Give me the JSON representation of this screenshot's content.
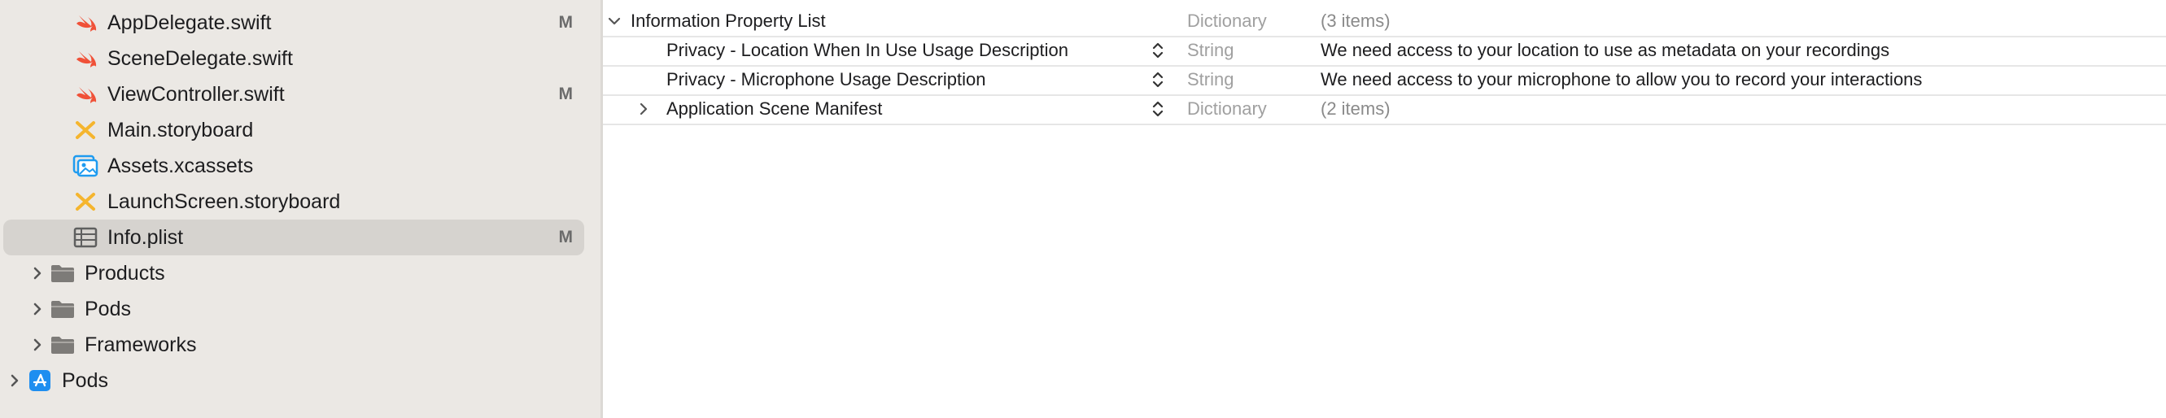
{
  "navigator": {
    "files": [
      {
        "name": "AppDelegate.swift",
        "icon": "swift-icon",
        "badge": "M"
      },
      {
        "name": "SceneDelegate.swift",
        "icon": "swift-icon",
        "badge": ""
      },
      {
        "name": "ViewController.swift",
        "icon": "swift-icon",
        "badge": "M"
      },
      {
        "name": "Main.storyboard",
        "icon": "storyboard-icon",
        "badge": ""
      },
      {
        "name": "Assets.xcassets",
        "icon": "asset-catalog-icon",
        "badge": ""
      },
      {
        "name": "LaunchScreen.storyboard",
        "icon": "storyboard-icon",
        "badge": ""
      },
      {
        "name": "Info.plist",
        "icon": "plist-icon",
        "badge": "M",
        "selected": true
      }
    ],
    "groups": [
      {
        "name": "Products",
        "icon": "folder-icon"
      },
      {
        "name": "Pods",
        "icon": "folder-icon"
      },
      {
        "name": "Frameworks",
        "icon": "folder-icon"
      }
    ],
    "projects": [
      {
        "name": "Pods",
        "icon": "xcode-project-icon"
      }
    ],
    "colors": {
      "swift": "#f05138",
      "storyboard": "#f5b52e",
      "assets": "#1e9bf0",
      "folder": "#7d7b78",
      "selected_bg": "#d6d3cf"
    }
  },
  "plist": {
    "root": {
      "key": "Information Property List",
      "type": "Dictionary",
      "value": "(3 items)",
      "expanded": true
    },
    "rows": [
      {
        "key": "Privacy - Location When In Use Usage Description",
        "type": "String",
        "value": "We need access to your location to use as metadata on your recordings"
      },
      {
        "key": "Privacy - Microphone Usage Description",
        "type": "String",
        "value": "We need access to your microphone to allow you to record your interactions"
      },
      {
        "key": "Application Scene Manifest",
        "type": "Dictionary",
        "value": "(2 items)",
        "expandable": true
      }
    ]
  }
}
